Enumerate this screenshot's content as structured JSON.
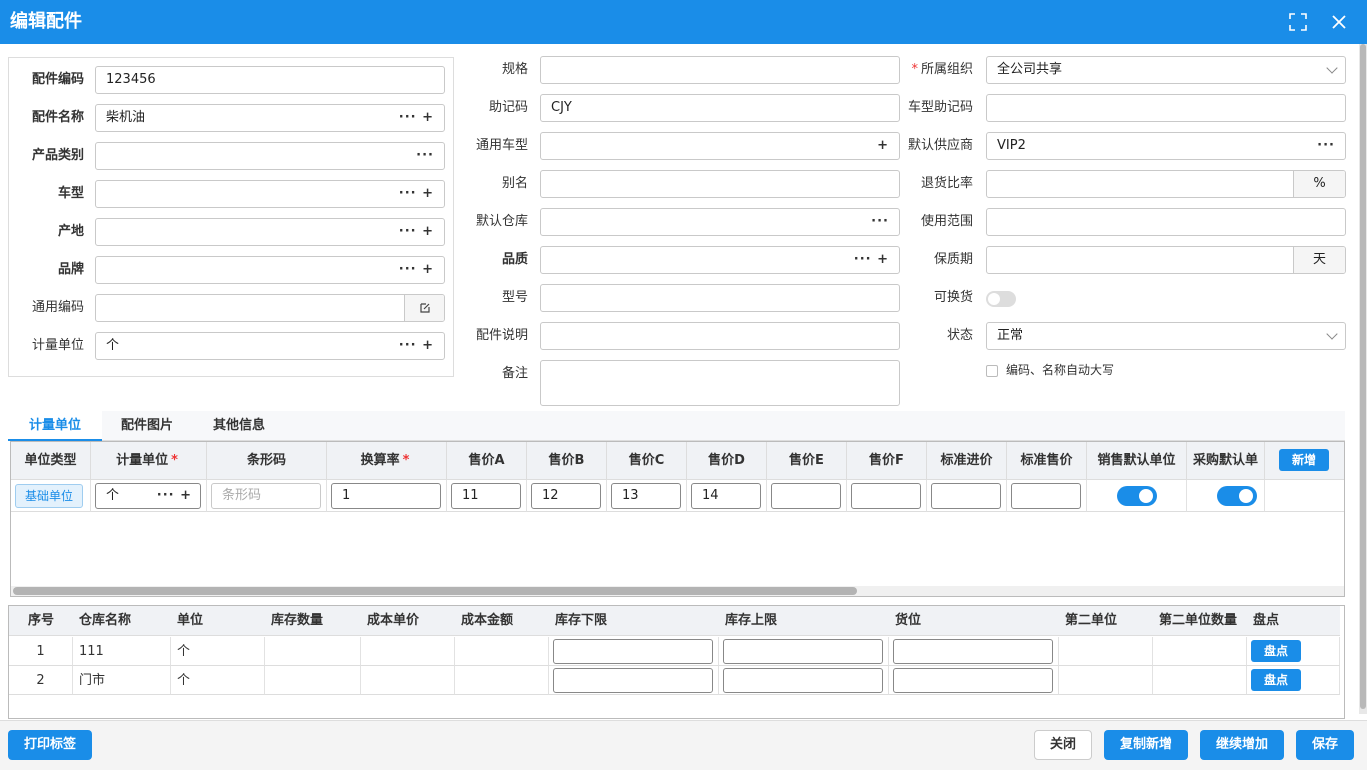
{
  "window": {
    "title": "编辑配件"
  },
  "left_form": [
    {
      "label": "配件编码",
      "value": "123456",
      "bold": true,
      "suffix": ""
    },
    {
      "label": "配件名称",
      "value": "柴机油",
      "bold": true,
      "suffix": "··· +"
    },
    {
      "label": "产品类别",
      "value": "",
      "bold": true,
      "suffix": "···"
    },
    {
      "label": "车型",
      "value": "",
      "bold": true,
      "suffix": "··· +"
    },
    {
      "label": "产地",
      "value": "",
      "bold": true,
      "suffix": "··· +"
    },
    {
      "label": "品牌",
      "value": "",
      "bold": true,
      "suffix": "··· +"
    },
    {
      "label": "通用编码",
      "value": "",
      "bold": false,
      "suffix": "edit"
    },
    {
      "label": "计量单位",
      "value": "个",
      "bold": false,
      "suffix": "··· +"
    }
  ],
  "middle_form": [
    {
      "label": "规格",
      "value": "",
      "bold": false,
      "suffix": ""
    },
    {
      "label": "助记码",
      "value": "CJY",
      "bold": false,
      "suffix": ""
    },
    {
      "label": "通用车型",
      "value": "",
      "bold": false,
      "suffix": "+"
    },
    {
      "label": "别名",
      "value": "",
      "bold": false,
      "suffix": ""
    },
    {
      "label": "默认仓库",
      "value": "",
      "bold": false,
      "suffix": "···"
    },
    {
      "label": "品质",
      "value": "",
      "bold": true,
      "suffix": "··· +"
    },
    {
      "label": "型号",
      "value": "",
      "bold": false,
      "suffix": ""
    },
    {
      "label": "配件说明",
      "value": "",
      "bold": false,
      "suffix": ""
    },
    {
      "label": "备注",
      "value": "",
      "bold": false,
      "suffix": ""
    }
  ],
  "right_form": {
    "org_label": "所属组织",
    "org_value": "全公司共享",
    "model_code_label": "车型助记码",
    "model_code_value": "",
    "supplier_label": "默认供应商",
    "supplier_value": "VIP2",
    "supplier_suffix": "···",
    "return_label": "退货比率",
    "return_value": "",
    "return_unit": "%",
    "scope_label": "使用范围",
    "scope_value": "",
    "shelf_label": "保质期",
    "shelf_value": "",
    "shelf_unit": "天",
    "exchange_label": "可换货",
    "exchange_on": false,
    "status_label": "状态",
    "status_value": "正常",
    "uppercase_label": "编码、名称自动大写",
    "uppercase_checked": false
  },
  "tabs": [
    "计量单位",
    "配件图片",
    "其他信息"
  ],
  "unit_grid": {
    "headers": [
      "单位类型",
      "计量单位",
      "条形码",
      "换算率",
      "售价A",
      "售价B",
      "售价C",
      "售价D",
      "售价E",
      "售价F",
      "标准进价",
      "标准售价",
      "销售默认单位",
      "采购默认单"
    ],
    "required": [
      false,
      true,
      false,
      true,
      false,
      false,
      false,
      false,
      false,
      false,
      false,
      false,
      false,
      false
    ],
    "add_button": "新增",
    "row": {
      "type": "基础单位",
      "unit": "个",
      "unit_suffix": "··· +",
      "barcode_placeholder": "条形码",
      "rate": "1",
      "price_a": "11",
      "price_b": "12",
      "price_c": "13",
      "price_d": "14",
      "price_e": "",
      "price_f": "",
      "std_in": "",
      "std_out": "",
      "sale_default": true,
      "purchase_default": true
    }
  },
  "stock_grid": {
    "headers": [
      "序号",
      "仓库名称",
      "单位",
      "库存数量",
      "成本单价",
      "成本金额",
      "库存下限",
      "库存上限",
      "货位",
      "第二单位",
      "第二单位数量",
      "盘点"
    ],
    "rows": [
      {
        "no": "1",
        "warehouse": "111",
        "unit": "个",
        "action": "盘点"
      },
      {
        "no": "2",
        "warehouse": "门市",
        "unit": "个",
        "action": "盘点"
      }
    ]
  },
  "footer": {
    "print": "打印标签",
    "close": "关闭",
    "copy_new": "复制新增",
    "continue_add": "继续增加",
    "save": "保存"
  },
  "colors": {
    "primary": "#1a8de8",
    "required": "#e33333"
  }
}
